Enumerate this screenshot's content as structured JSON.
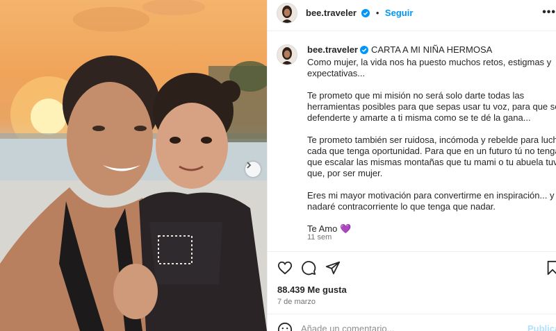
{
  "header": {
    "username": "bee.traveler",
    "separator": "•",
    "follow_label": "Seguir",
    "more_label": "•••"
  },
  "caption": {
    "username": "bee.traveler",
    "title": "CARTA A MI NIÑA HERMOSA",
    "paragraphs": [
      [
        "Como mujer, la vida nos ha puesto muchos retos, estigmas y",
        "expectativas..."
      ],
      [
        "Te prometo que mi misión no será solo darte todas las",
        "herramientas posibles para que sepas usar tu voz, para que sepas",
        "defenderte y amarte a ti misma como se te dé la gana..."
      ],
      [
        "Te prometo también ser ruidosa, incómoda y rebelde para luchar",
        "cada que tenga oportunidad. Para que en un futuro tú no tengas",
        "que escalar las mismas montañas que tu mami o tu abuela tuvieron",
        "que, por ser mujer."
      ],
      [
        "Eres mi mayor motivación para convertirme en inspiración... y por ti",
        "nadaré contracorriente lo que tenga que nadar."
      ],
      [
        "Te Amo 💜"
      ]
    ],
    "time_ago": "11 sem"
  },
  "stats": {
    "likes": "88.439 Me gusta",
    "date": "7 de marzo"
  },
  "comment": {
    "placeholder": "Añade un comentario...",
    "post_label": "Publicar"
  },
  "icons": {
    "like": "heart-icon",
    "comment": "comment-icon",
    "share": "paper-plane-icon",
    "save": "bookmark-icon",
    "emoji": "emoji-icon",
    "verified": "verified-badge-icon",
    "carousel": "chevron-right-icon"
  },
  "colors": {
    "accent": "#0095f6",
    "verified": "#0095f6",
    "muted": "#737373",
    "text": "#262626"
  }
}
